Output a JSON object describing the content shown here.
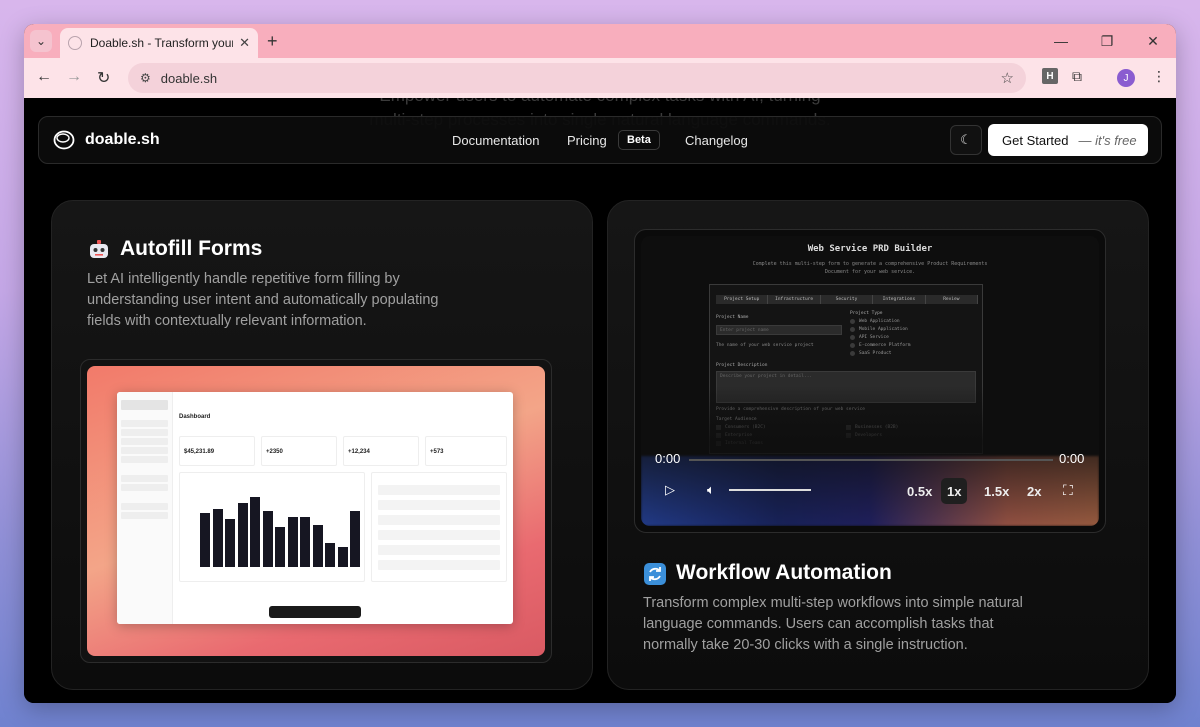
{
  "browser": {
    "tab_title": "Doable.sh - Transform your web",
    "tab_close": "✕",
    "new_tab": "+",
    "url": "doable.sh",
    "avatar_letter": "J",
    "ext_letter": "H"
  },
  "ghost": {
    "line1": "Empower users to automate complex tasks with AI, turning",
    "line2": "multi-step processes into single natural language commands."
  },
  "nav": {
    "brand": "doable.sh",
    "links": [
      "Documentation",
      "Pricing",
      "Changelog"
    ],
    "beta": "Beta",
    "cta_main": "Get Started",
    "cta_note": "— it's free"
  },
  "cards": {
    "left": {
      "title": "Autofill Forms",
      "description": "Let AI intelligently handle repetitive form filling by understanding user intent and automatically populating fields with contextually relevant information."
    },
    "right": {
      "title": "Workflow Automation",
      "description": "Transform complex multi-step workflows into simple natural language commands. Users can accomplish tasks that normally take 20-30 clicks with a single instruction."
    }
  },
  "dashboard_mock": {
    "title": "Dashboard",
    "kpis": [
      "$45,231.89",
      "+2350",
      "+12,234",
      "+573"
    ],
    "bar_fraction": [
      0.68,
      0.72,
      0.6,
      0.8,
      0.87,
      0.7,
      0.5,
      0.62,
      0.62,
      0.52,
      0.3,
      0.25,
      0.7
    ]
  },
  "video": {
    "prd_title": "Web Service PRD Builder",
    "prd_subtitle": "Complete this multi-step form to generate a comprehensive Product Requirements Document for your web service.",
    "prd_tabs": [
      "Project Setup",
      "Infrastructure",
      "Security",
      "Integrations",
      "Review"
    ],
    "project_name_label": "Project Name",
    "project_name_placeholder": "Enter project name",
    "project_name_help": "The name of your web service project",
    "project_type_label": "Project Type",
    "project_types": [
      "Web Application",
      "Mobile Application",
      "API Service",
      "E-commerce Platform",
      "SaaS Product"
    ],
    "description_label": "Project Description",
    "description_placeholder": "Describe your project in detail...",
    "description_help": "Provide a comprehensive description of your web service",
    "audience_label": "Target Audience",
    "audience_left": [
      "Consumers (B2C)",
      "Enterprise",
      "Internal Teams"
    ],
    "audience_right": [
      "Businesses (B2B)",
      "Developers"
    ],
    "time_current": "0:00",
    "time_total": "0:00",
    "rates": [
      "0.5x",
      "1x",
      "1.5x",
      "2x"
    ]
  }
}
